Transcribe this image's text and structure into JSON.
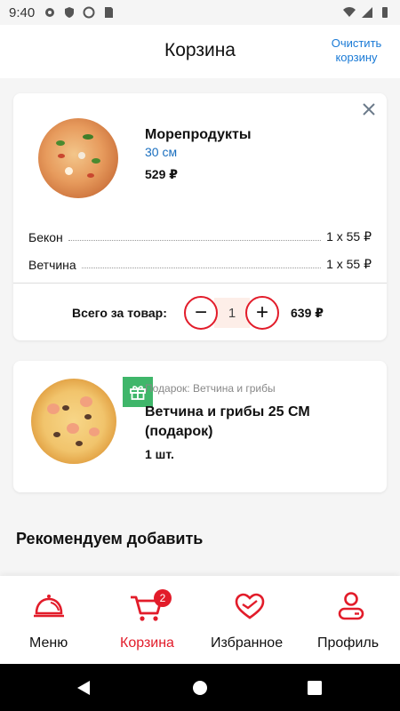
{
  "status_bar": {
    "time": "9:40"
  },
  "header": {
    "title": "Корзина",
    "clear_label": "Очистить корзину"
  },
  "cart_item": {
    "name": "Морепродукты",
    "size": "30 см",
    "price": "529 ₽",
    "toppings": [
      {
        "name": "Бекон",
        "qty_price": "1 x 55 ₽"
      },
      {
        "name": "Ветчина",
        "qty_price": "1 x 55 ₽"
      }
    ],
    "total_label": "Всего за товар:",
    "quantity": "1",
    "total_price": "639 ₽",
    "minus_symbol": "−",
    "plus_symbol": "+"
  },
  "gift_item": {
    "caption": "Подарок: Ветчина и грибы",
    "name": "Ветчина и грибы 25 СМ (подарок)",
    "qty": "1 шт."
  },
  "recommend_title": "Рекомендуем добавить",
  "bottom_nav": {
    "items": [
      {
        "label": "Меню",
        "icon": "cloche-icon"
      },
      {
        "label": "Корзина",
        "icon": "cart-icon",
        "badge": "2",
        "active": true
      },
      {
        "label": "Избранное",
        "icon": "heart-icon"
      },
      {
        "label": "Профиль",
        "icon": "profile-icon"
      }
    ]
  },
  "colors": {
    "accent": "#e21c2a",
    "link": "#1a7ad6",
    "gift": "#3fb66a"
  }
}
